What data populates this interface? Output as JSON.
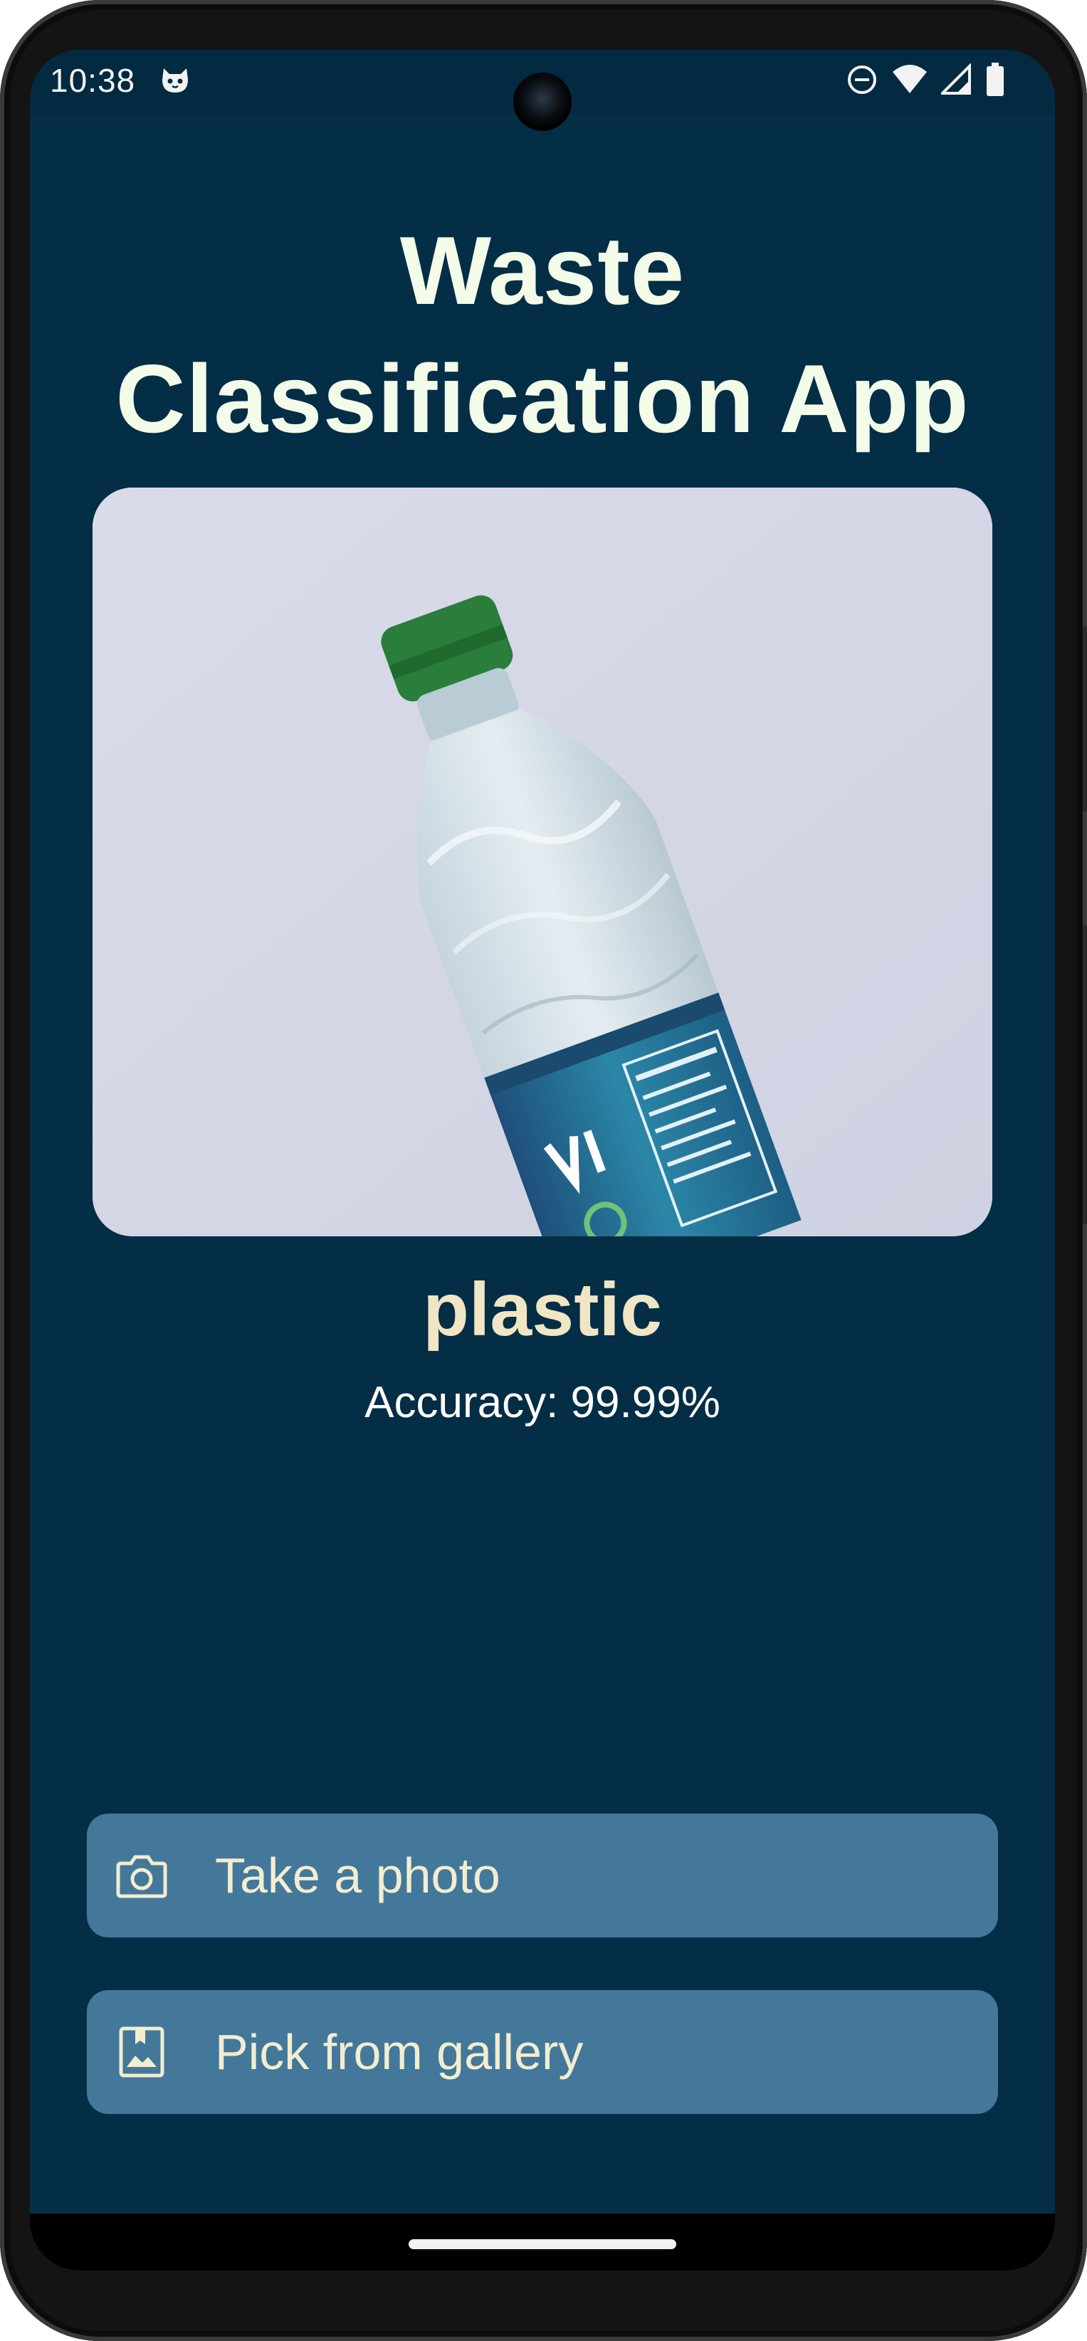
{
  "status_bar": {
    "time": "10:38",
    "left_icon": "cat-face-icon",
    "right_icons": [
      "do-not-disturb-icon",
      "wifi-icon",
      "signal-icon",
      "battery-icon"
    ]
  },
  "app": {
    "title": "Waste Classification App",
    "image_subject": "plastic-bottle-photo"
  },
  "result": {
    "label": "plastic",
    "accuracy_text": "Accuracy: 99.99%"
  },
  "actions": {
    "take_photo": {
      "label": "Take a photo",
      "icon": "camera-icon"
    },
    "pick_gallery": {
      "label": "Pick from gallery",
      "icon": "gallery-icon"
    }
  },
  "colors": {
    "background": "#042d46",
    "button": "#43789b",
    "title": "#f3fbe9",
    "label": "#f0e6c4"
  }
}
